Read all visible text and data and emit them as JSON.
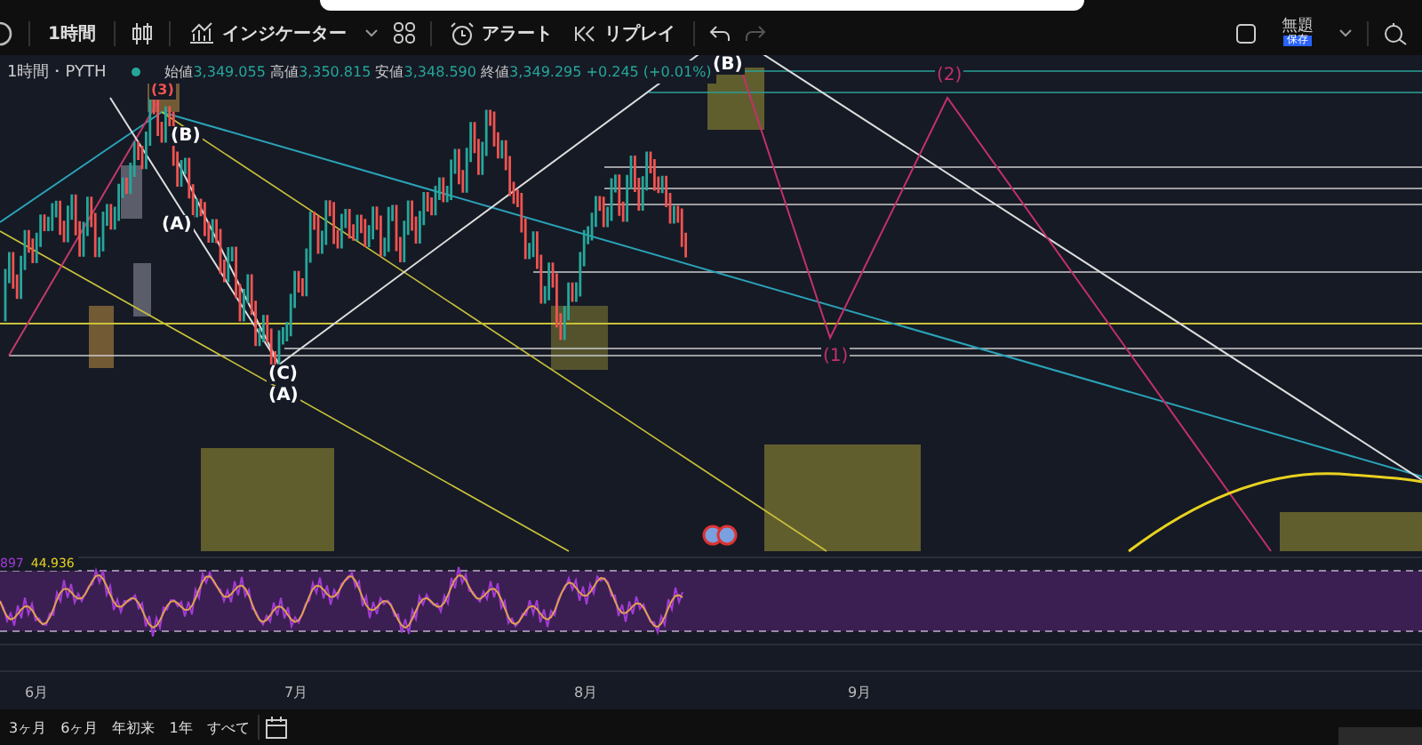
{
  "toolbar": {
    "interval": "1時間",
    "indicators_label": "インジケーター",
    "alert_label": "アラート",
    "replay_label": "リプレイ",
    "layout_name": "無題",
    "layout_status": "保存"
  },
  "legend": {
    "symbol": "1時間・PYTH",
    "open_label": "始値",
    "open": "3,349.055",
    "high_label": "高値",
    "high": "3,350.815",
    "low_label": "安値",
    "low": "3,348.590",
    "close_label": "終値",
    "close": "3,349.295",
    "change": "+0.245 (+0.01%)"
  },
  "wave_labels": [
    {
      "text": "(3)",
      "kind": "red"
    },
    {
      "text": "(B)",
      "kind": "white"
    },
    {
      "text": "(A)",
      "kind": "white"
    },
    {
      "text": "(C)",
      "kind": "white"
    },
    {
      "text": "(A)",
      "kind": "white"
    },
    {
      "text": "(B)",
      "kind": "white"
    },
    {
      "text": "(2)",
      "kind": "magenta"
    },
    {
      "text": "(1)",
      "kind": "magenta"
    }
  ],
  "rsi": {
    "value_a": "897",
    "value_b": "44.936"
  },
  "time_axis": [
    "6月",
    "7月",
    "8月",
    "9月"
  ],
  "ranges": [
    "3ヶ月",
    "6ヶ月",
    "年初来",
    "1年",
    "すべて"
  ]
}
